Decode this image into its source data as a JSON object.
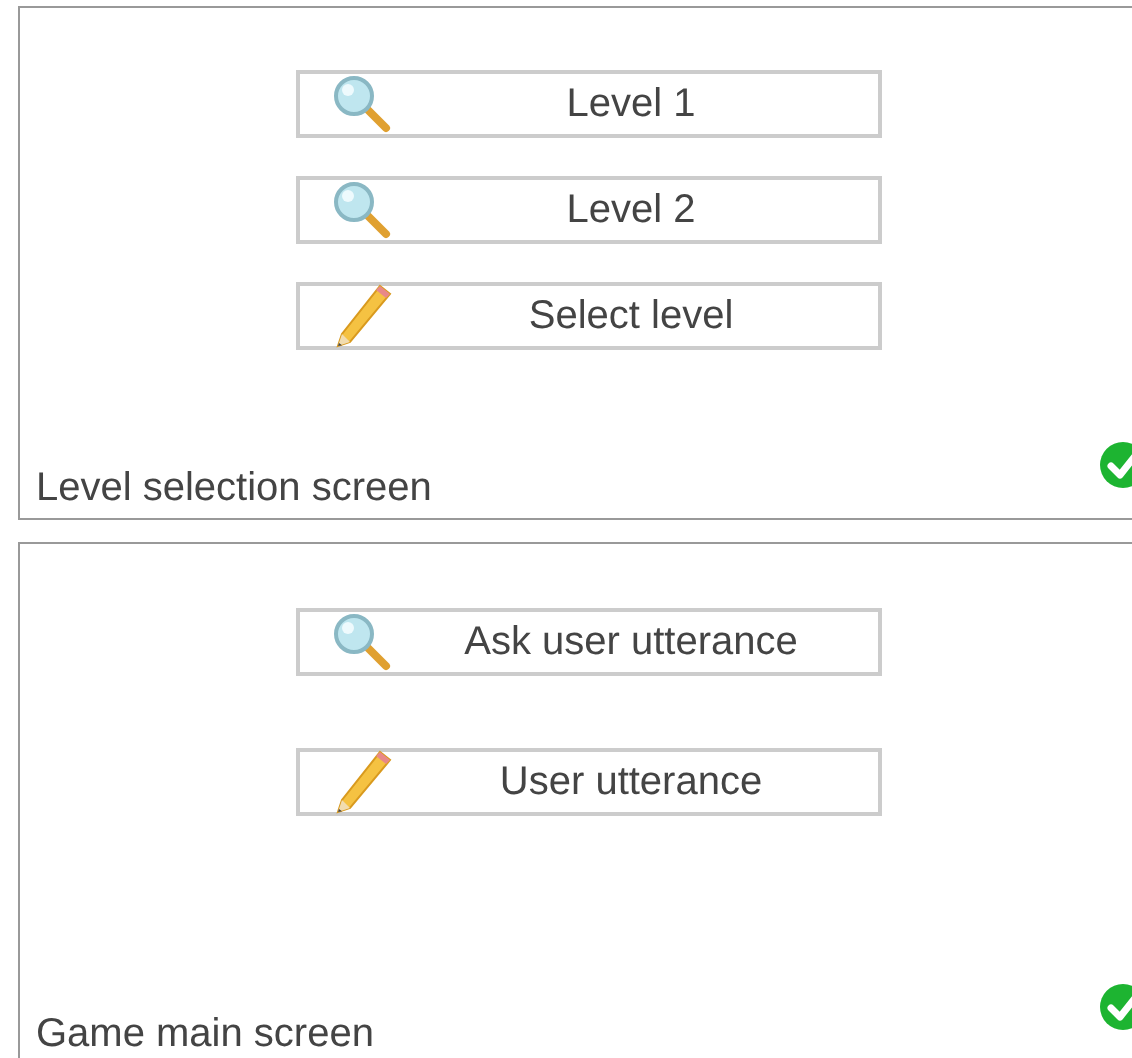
{
  "screens": [
    {
      "title": "Level selection screen",
      "complete": true,
      "buttons": [
        {
          "label": "Level 1",
          "kind": "search"
        },
        {
          "label": "Level 2",
          "kind": "search"
        },
        {
          "label": "Select level",
          "kind": "edit"
        }
      ]
    },
    {
      "title": "Game main screen",
      "complete": true,
      "buttons": [
        {
          "label": "Ask user utterance",
          "kind": "search"
        },
        {
          "label": "User utterance",
          "kind": "edit"
        }
      ]
    }
  ]
}
